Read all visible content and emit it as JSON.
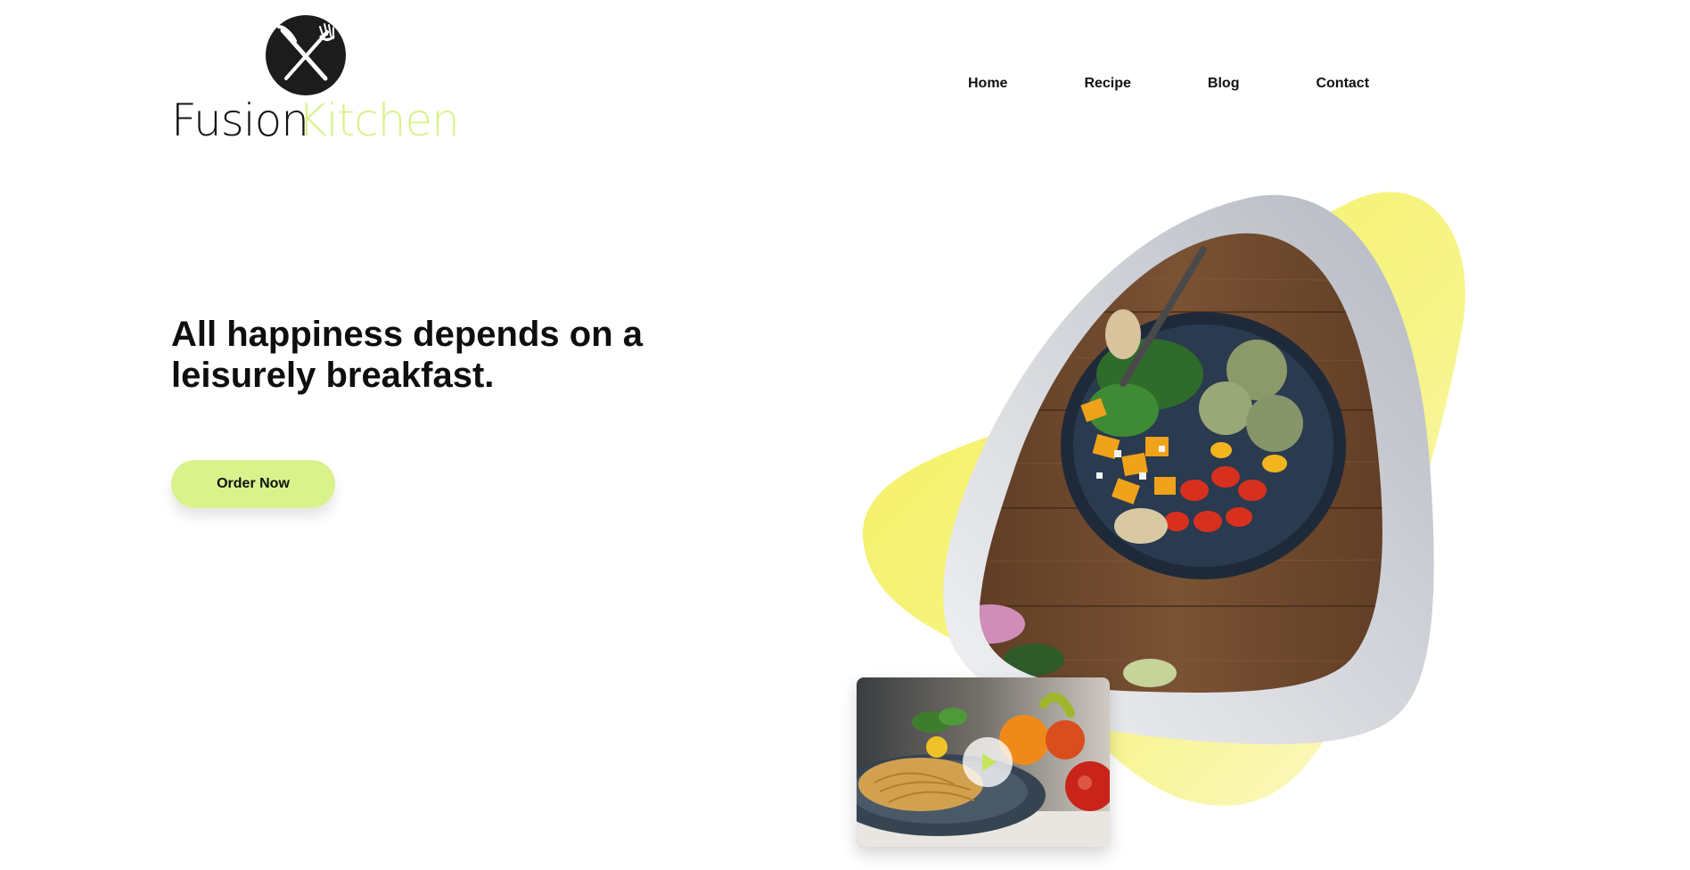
{
  "brand": {
    "name_part_1": "Fusion",
    "name_part_2": "Kitchen",
    "accent_color": "#d9f28c",
    "dark_color": "#141414",
    "icon": "fork-knife-cross-icon"
  },
  "nav": {
    "items": [
      {
        "label": "Home"
      },
      {
        "label": "Recipe"
      },
      {
        "label": "Blog"
      },
      {
        "label": "Contact"
      }
    ]
  },
  "hero": {
    "headline": "All happiness depends on a leisurely breakfast.",
    "cta_label": "Order Now",
    "cta_color": "#d9f28c"
  },
  "visual": {
    "main_image": "salad-bowl-on-wooden-table",
    "video_thumbnail": "spaghetti-plate-with-vegetables",
    "play_icon": "play-icon",
    "blob_color": "#f6f07a",
    "frame_color": "#c3c6cd"
  }
}
